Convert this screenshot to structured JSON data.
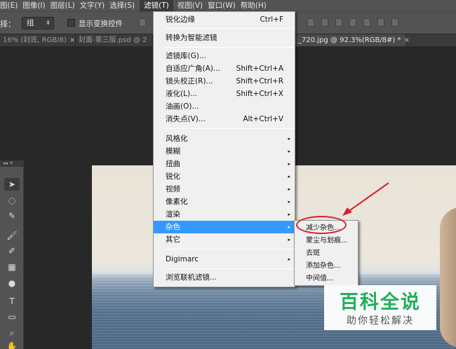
{
  "menubar": {
    "items": [
      "图(E)",
      "图像(I)",
      "图层(L)",
      "文字(Y)",
      "选择(S)",
      "滤镜(T)",
      "视图(V)",
      "窗口(W)",
      "帮助(H)"
    ]
  },
  "options": {
    "select_label": "择：",
    "select_value": "组",
    "show_transform": "显示变换控件"
  },
  "tabs": [
    {
      "label": "16% (封底, RGB/8)",
      "close": "×"
    },
    {
      "label": "封面-第三版.psd @ 2",
      "close": ""
    },
    {
      "label": "_720.jpg @ 92.3%(RGB/8#) *",
      "close": "×"
    }
  ],
  "filter_menu": {
    "items": [
      {
        "label": "锐化边缘",
        "shortcut": "Ctrl+F"
      },
      {
        "label": "转换为智能滤镜",
        "shortcut": ""
      },
      {
        "label": "滤镜库(G)...",
        "shortcut": ""
      },
      {
        "label": "自适应广角(A)...",
        "shortcut": "Shift+Ctrl+A"
      },
      {
        "label": "镜头校正(R)...",
        "shortcut": "Shift+Ctrl+R"
      },
      {
        "label": "液化(L)...",
        "shortcut": "Shift+Ctrl+X"
      },
      {
        "label": "油画(O)...",
        "shortcut": ""
      },
      {
        "label": "消失点(V)...",
        "shortcut": "Alt+Ctrl+V"
      },
      {
        "label": "风格化",
        "shortcut": ""
      },
      {
        "label": "模糊",
        "shortcut": ""
      },
      {
        "label": "扭曲",
        "shortcut": ""
      },
      {
        "label": "锐化",
        "shortcut": ""
      },
      {
        "label": "视频",
        "shortcut": ""
      },
      {
        "label": "像素化",
        "shortcut": ""
      },
      {
        "label": "渲染",
        "shortcut": ""
      },
      {
        "label": "杂色",
        "shortcut": ""
      },
      {
        "label": "其它",
        "shortcut": ""
      },
      {
        "label": "Digimarc",
        "shortcut": ""
      },
      {
        "label": "浏览联机滤镜...",
        "shortcut": ""
      }
    ],
    "submenu_glyph": "▸"
  },
  "noise_submenu": {
    "items": [
      "减少杂色...",
      "蒙尘与划痕...",
      "去斑",
      "添加杂色...",
      "中间值..."
    ]
  },
  "watermark": {
    "title": "百科全说",
    "subtitle": "助你轻松解决"
  },
  "colors": {
    "highlight": "#3399ff",
    "annotation": "#d8202a",
    "watermark_green": "#23b05a"
  }
}
